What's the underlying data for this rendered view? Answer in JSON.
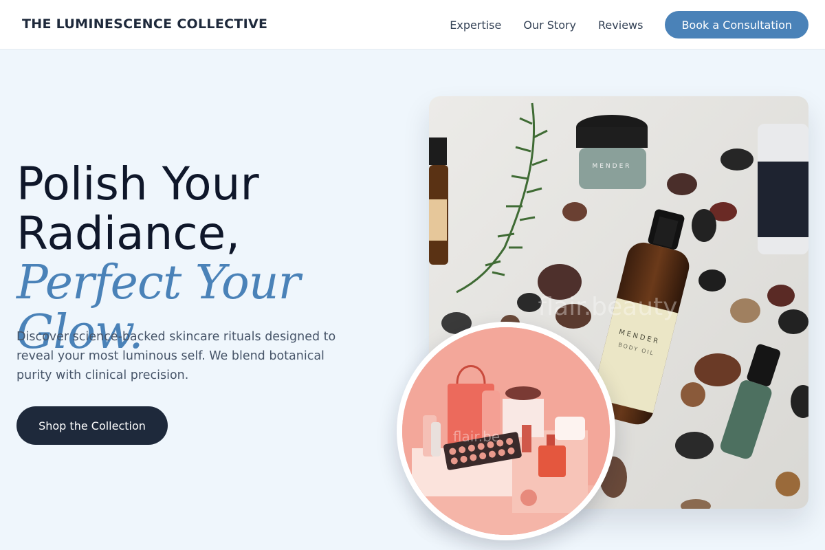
{
  "brand": {
    "name": "THE LUMINESCENCE COLLECTIVE"
  },
  "nav": {
    "links": [
      {
        "label": "Expertise"
      },
      {
        "label": "Our Story"
      },
      {
        "label": "Reviews"
      }
    ],
    "cta_label": "Book a Consultation"
  },
  "hero": {
    "title_line1": "Polish Your",
    "title_line2": "Radiance,",
    "title_accent": "Perfect Your Glow.",
    "description": "Discover science-backed skincare rituals designed to reveal your most luminous self. We blend botanical purity with clinical precision.",
    "button_label": "Shop the Collection"
  },
  "images": {
    "main_product_label": "MENDER",
    "main_product_sub": "BODY OIL",
    "jar_label": "MENDER",
    "watermark": "flair.beauty",
    "circle_watermark": "flair.be"
  },
  "colors": {
    "accent": "#4a82b8",
    "dark": "#1e293b",
    "background": "#eff6fc",
    "coral": "#f3a79a"
  }
}
